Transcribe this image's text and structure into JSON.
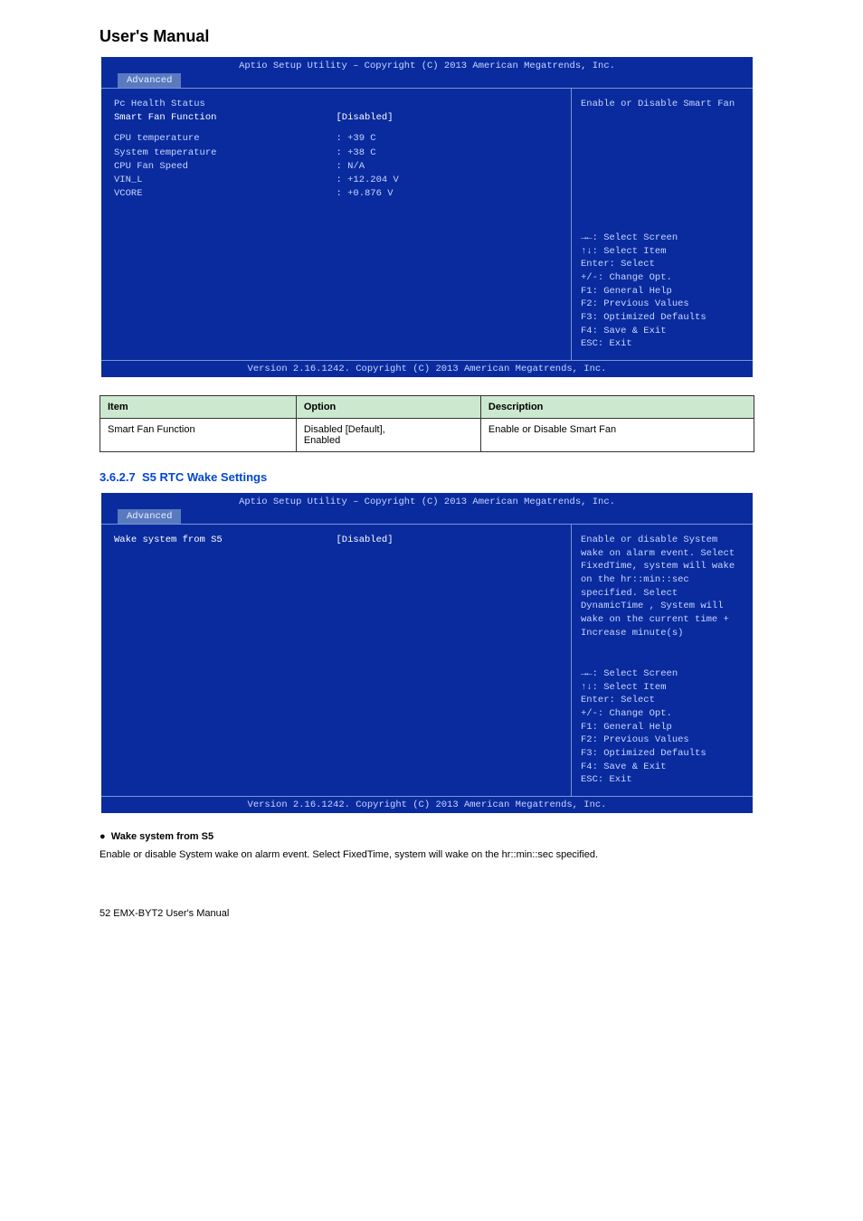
{
  "doc": {
    "title": "User's Manual",
    "page_footer": "52    EMX-BYT2 User's Manual"
  },
  "bios_common": {
    "title": "Aptio Setup Utility – Copyright (C) 2013 American Megatrends, Inc.",
    "tab": "Advanced",
    "footer": "Version 2.16.1242. Copyright (C) 2013 American Megatrends, Inc.",
    "nav": {
      "l1": "→←: Select Screen",
      "l2": "↑↓: Select Item",
      "l3": "Enter: Select",
      "l4": "+/-: Change Opt.",
      "l5": "F1: General Help",
      "l6": "F2: Previous Values",
      "l7": "F3: Optimized Defaults",
      "l8": "F4: Save & Exit",
      "l9": "ESC: Exit"
    }
  },
  "bios1": {
    "rows": {
      "r0": {
        "label": "Pc Health Status",
        "val": ""
      },
      "r1": {
        "label": "Smart Fan Function",
        "val": "[Disabled]"
      },
      "r2": {
        "label": "CPU temperature",
        "val": ": +39 C"
      },
      "r3": {
        "label": "System temperature",
        "val": ": +38 C"
      },
      "r4": {
        "label": "CPU Fan Speed",
        "val": ": N/A"
      },
      "r5": {
        "label": "VIN_L",
        "val": ": +12.204 V"
      },
      "r6": {
        "label": "VCORE",
        "val": ": +0.876 V"
      }
    },
    "help": "Enable or Disable Smart Fan"
  },
  "table1": {
    "h1": "Item",
    "h2": "Option",
    "h3": "Description",
    "c1": "Smart Fan Function",
    "c2": "Disabled [Default],\nEnabled",
    "c3": "Enable or Disable Smart Fan"
  },
  "sec1": {
    "num": "3.6.2.7",
    "title": "S5 RTC Wake Settings"
  },
  "bios2": {
    "rows": {
      "r1": {
        "label": "Wake system from S5",
        "val": "[Disabled]"
      }
    },
    "help": "Enable or disable System wake on alarm event. Select FixedTime, system will wake on the hr::min::sec specified. Select DynamicTime , System will wake on the current time + Increase minute(s)"
  },
  "bullet1": {
    "title": "Wake system from S5",
    "text": "Enable or disable System wake on alarm event. Select FixedTime, system will wake on the hr::min::sec specified."
  }
}
